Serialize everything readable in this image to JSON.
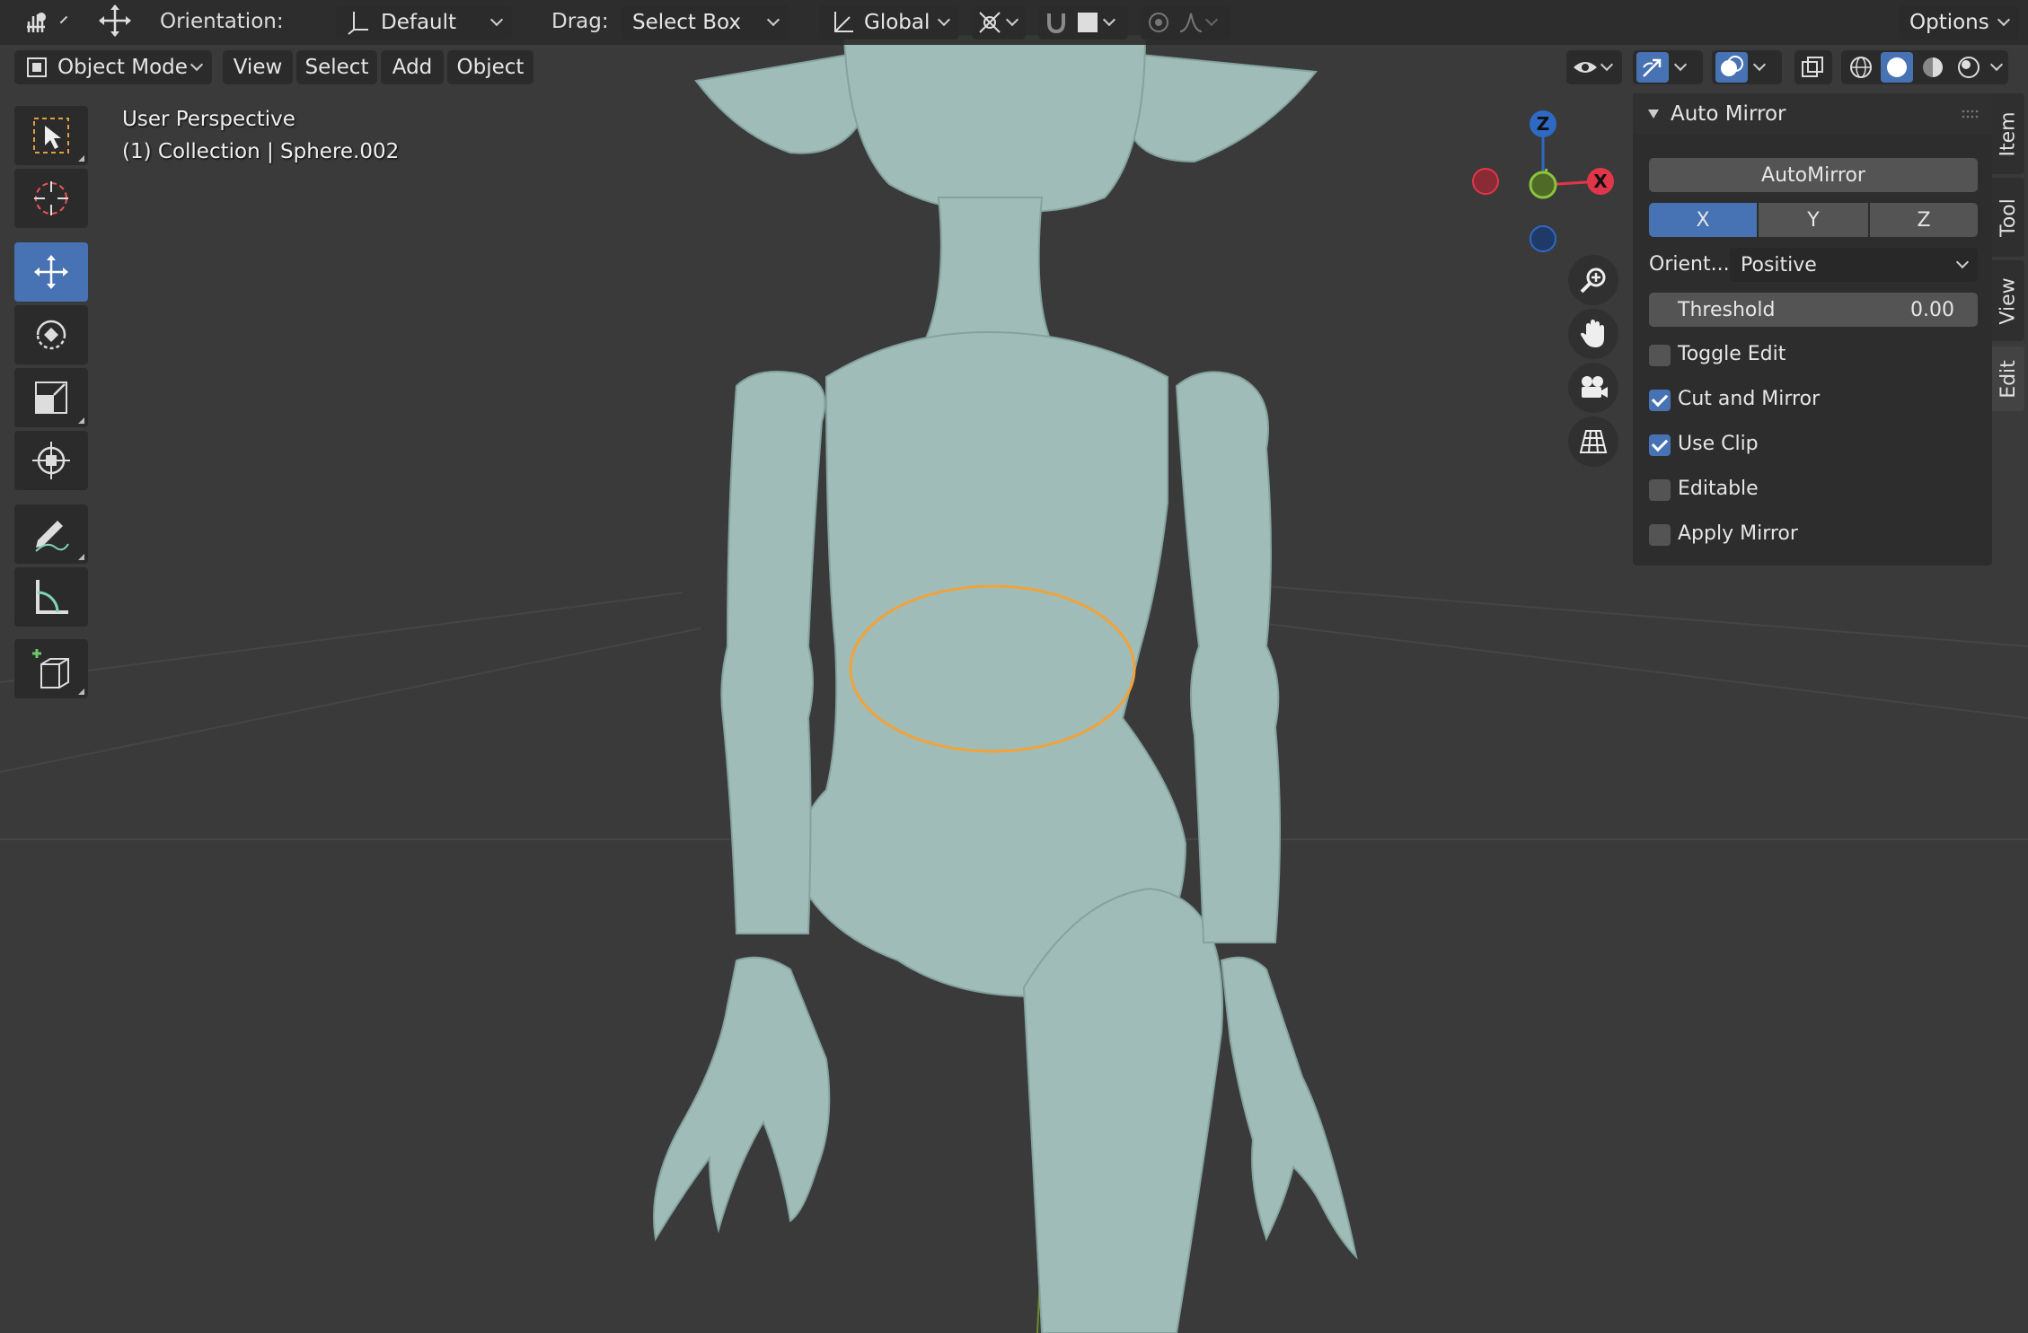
{
  "header": {
    "editor_icon": "hand-grab-editor-icon",
    "transform_icon": "move-arrows-icon",
    "orientation_label": "Orientation:",
    "orientation_value": "Default",
    "drag_label": "Drag:",
    "drag_value": "Select Box",
    "transform_space": "Global",
    "options_label": "Options"
  },
  "view_header": {
    "mode": "Object Mode",
    "menus": [
      "View",
      "Select",
      "Add",
      "Object"
    ]
  },
  "viewport": {
    "perspective": "User Perspective",
    "collection": "(1) Collection | Sphere.002",
    "gizmo": {
      "x": "X",
      "y": "Y",
      "z": "Z"
    },
    "colors": {
      "x_axis": "#e0364a",
      "y_axis": "#8bc43b",
      "z_axis": "#2e69c4",
      "selection": "#f0a33a",
      "mesh": "#9fbcb8"
    }
  },
  "tools": [
    {
      "name": "select-box-tool",
      "icon": "select-box-icon",
      "active": false
    },
    {
      "name": "cursor-tool",
      "icon": "cursor-icon",
      "active": false
    },
    {
      "name": "move-tool",
      "icon": "move-icon",
      "active": true
    },
    {
      "name": "rotate-tool",
      "icon": "rotate-icon",
      "active": false
    },
    {
      "name": "scale-tool",
      "icon": "scale-icon",
      "active": false
    },
    {
      "name": "transform-tool",
      "icon": "transform-icon",
      "active": false
    },
    {
      "name": "annotate-tool",
      "icon": "annotate-icon",
      "active": false
    },
    {
      "name": "measure-tool",
      "icon": "measure-icon",
      "active": false
    },
    {
      "name": "add-cube-tool",
      "icon": "add-cube-icon",
      "active": false
    }
  ],
  "panel": {
    "title": "Auto Mirror",
    "automirror_button": "AutoMirror",
    "axes": [
      {
        "label": "X",
        "on": true
      },
      {
        "label": "Y",
        "on": false
      },
      {
        "label": "Z",
        "on": false
      }
    ],
    "orient_label": "Orient...",
    "orient_value": "Positive",
    "threshold_label": "Threshold",
    "threshold_value": "0.00",
    "checkboxes": [
      {
        "label": "Toggle Edit",
        "checked": false
      },
      {
        "label": "Cut and Mirror",
        "checked": true
      },
      {
        "label": "Use Clip",
        "checked": true
      },
      {
        "label": "Editable",
        "checked": false
      },
      {
        "label": "Apply Mirror",
        "checked": false
      }
    ]
  },
  "side_tabs": [
    "Item",
    "Tool",
    "View",
    "Edit"
  ],
  "selected_tab": "Edit"
}
